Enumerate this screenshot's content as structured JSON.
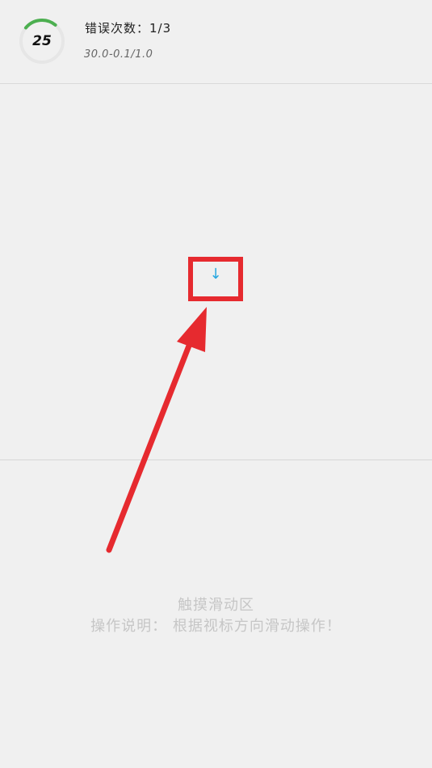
{
  "header": {
    "timer_value": "25",
    "timer_progress": 0.25,
    "error_label": "错误次数：1/3",
    "score_line": "30.0-0.1/1.0"
  },
  "arena": {
    "direction_glyph": "↓",
    "direction_icon": "arrow-down-icon"
  },
  "touch_area": {
    "title": "触摸滑动区",
    "instruction": "操作说明： 根据视标方向滑动操作！"
  },
  "colors": {
    "background": "#f0f0f0",
    "timer_arc": "#4caf50",
    "timer_track": "#e6e6e6",
    "highlight": "#e62a2f",
    "direction_glyph": "#27a7e0",
    "hint_text": "#c6c6c6"
  }
}
